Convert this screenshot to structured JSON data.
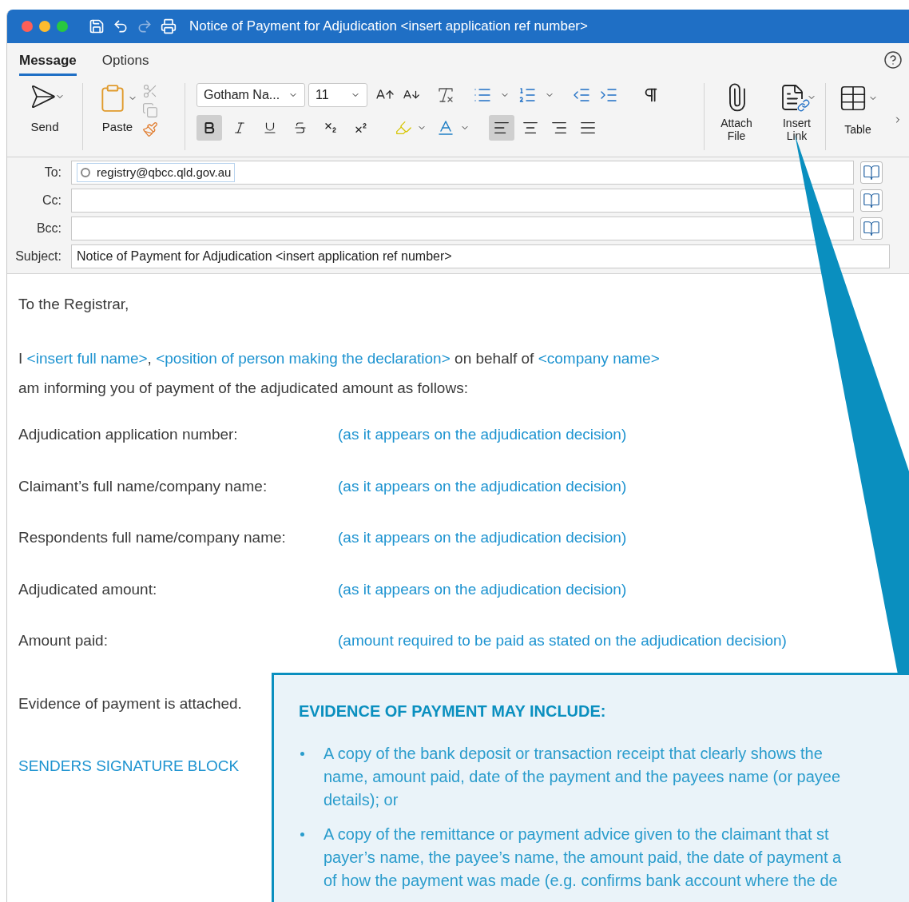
{
  "window": {
    "title": "Notice of Payment for Adjudication <insert application ref number>"
  },
  "tabs": [
    {
      "label": "Message",
      "selected": true
    },
    {
      "label": "Options",
      "selected": false
    }
  ],
  "ribbon": {
    "send": "Send",
    "paste": "Paste",
    "font_name": "Gotham Na...",
    "font_size": "11",
    "attach": "Attach File",
    "insert_link": "Insert Link",
    "table": "Table",
    "format_buttons": [
      {
        "kind": "bold",
        "selected": true
      },
      {
        "kind": "italic",
        "selected": false
      },
      {
        "kind": "underline",
        "selected": false
      },
      {
        "kind": "strike",
        "selected": false
      },
      {
        "kind": "subscript",
        "selected": false
      },
      {
        "kind": "superscript",
        "selected": false
      }
    ],
    "align_buttons": [
      {
        "kind": "left",
        "selected": true
      },
      {
        "kind": "center",
        "selected": false
      },
      {
        "kind": "right",
        "selected": false
      },
      {
        "kind": "justify",
        "selected": false
      }
    ]
  },
  "header_fields": [
    {
      "kind": "address",
      "label": "To:",
      "recipient": "registry@qbcc.qld.gov.au"
    },
    {
      "kind": "address",
      "label": "Cc:"
    },
    {
      "kind": "address",
      "label": "Bcc:"
    },
    {
      "kind": "subject",
      "label": "Subject:",
      "value": "Notice of Payment for Adjudication <insert application ref number>"
    }
  ],
  "body": {
    "greeting": "To the Registrar,",
    "intro": [
      {
        "kind": "plain",
        "text": "I "
      },
      {
        "kind": "placeholder",
        "text": "<insert full name>"
      },
      {
        "kind": "plain",
        "text": ", "
      },
      {
        "kind": "placeholder",
        "text": "<position of person making the declaration>"
      },
      {
        "kind": "plain",
        "text": " on behalf of "
      },
      {
        "kind": "placeholder",
        "text": "<company name>"
      }
    ],
    "intro_line_2": "am informing you of payment of the adjudicated amount as follows:",
    "details": [
      {
        "label": "Adjudication application number:",
        "value": "(as it appears on the adjudication decision)"
      },
      {
        "label": "Claimant’s full name/company name:",
        "value": "(as it appears on the adjudication decision)"
      },
      {
        "label": "Respondents full name/company name:",
        "value": "(as it appears on the adjudication decision)"
      },
      {
        "label": "Adjudicated amount:",
        "value": "(as it appears on the adjudication decision)"
      },
      {
        "label": "Amount paid:",
        "value": "(amount required to be paid as stated on the adjudication decision)"
      }
    ],
    "evidence": "Evidence of payment is attached.",
    "signature": "SENDERS SIGNATURE BLOCK"
  },
  "callout": {
    "title": "EVIDENCE OF PAYMENT MAY INCLUDE:",
    "bullets": [
      [
        "A copy of the bank deposit or transaction receipt that clearly shows the",
        "name, amount paid, date of the payment and the payees name (or payee",
        "details); or"
      ],
      [
        "A copy of the remittance or payment advice given to the claimant that st",
        "payer’s name, the payee’s name, the amount paid, the date of payment a",
        "of how the payment was made (e.g. confirms bank account where the de"
      ]
    ]
  }
}
